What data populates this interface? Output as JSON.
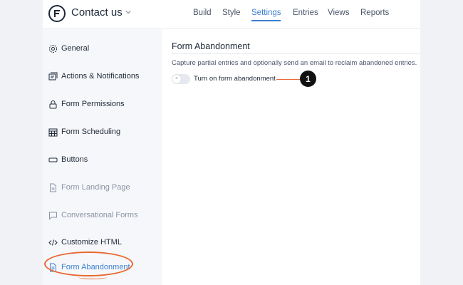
{
  "header": {
    "form_title": "Contact us",
    "tabs": [
      {
        "label": "Build"
      },
      {
        "label": "Style"
      },
      {
        "label": "Settings",
        "active": true
      },
      {
        "label": "Entries"
      },
      {
        "label": "Views"
      },
      {
        "label": "Reports"
      }
    ],
    "accent_color": "#3b7fd0"
  },
  "sidebar": {
    "items": [
      {
        "label": "General",
        "icon": "gear-icon"
      },
      {
        "label": "Actions & Notifications",
        "icon": "notifications-icon"
      },
      {
        "label": "Form Permissions",
        "icon": "lock-icon"
      },
      {
        "label": "Form Scheduling",
        "icon": "calendar-icon"
      },
      {
        "label": "Buttons",
        "icon": "button-icon"
      },
      {
        "label": "Form Landing Page",
        "icon": "page-icon",
        "muted": true
      },
      {
        "label": "Conversational Forms",
        "icon": "chat-icon",
        "muted": true
      },
      {
        "label": "Customize HTML",
        "icon": "code-icon"
      },
      {
        "label": "Form Abandonment",
        "icon": "form-abandonment-icon",
        "active": true
      }
    ]
  },
  "main": {
    "section_title": "Form Abandonment",
    "description": "Capture partial entries and optionally send an email to reclaim abandoned entries.",
    "toggle": {
      "label": "Turn on form abandonment",
      "on": false,
      "knob_glyph": "×"
    },
    "callout_number": "1"
  },
  "annotation_color": "#e8692f"
}
